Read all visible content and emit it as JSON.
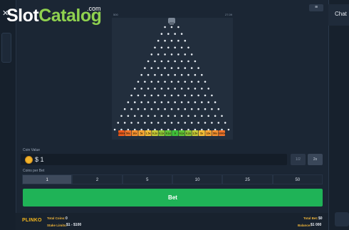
{
  "watermark": {
    "slot": "Slot",
    "catalog": "Catalog",
    "com": ".com"
  },
  "close_glyph": "✕",
  "chat": {
    "label": "Chat"
  },
  "menu_glyph": "≡",
  "board": {
    "left_label": "500",
    "right_label": "27.09",
    "rows": 16,
    "multipliers": [
      "1000x",
      "50x",
      "10x",
      "5x",
      "1.5x",
      "0.2x",
      "0.1x",
      "0.1x",
      "0",
      "0.1x",
      "0.2x",
      "1.5x",
      "5x",
      "10x",
      "50x",
      "1000x"
    ],
    "slot_colors": [
      "#ee5a1c",
      "#f0742a",
      "#f3902f",
      "#f5a533",
      "#f2bd36",
      "#c3c937",
      "#8cc637",
      "#5fc236",
      "#3fbf39",
      "#5fc236",
      "#8cc637",
      "#c3c937",
      "#f2bd36",
      "#f5a533",
      "#f3902f",
      "#f0742a",
      "#ee5a1c"
    ]
  },
  "bet_panel": {
    "coin_value_label": "Coin Value",
    "coin_value": "$ 1",
    "half_label": "1/2",
    "double_label": "2x",
    "coins_per_bet_label": "Coins per Bet",
    "coins_options": [
      "1",
      "2",
      "5",
      "10",
      "25",
      "50"
    ],
    "coins_selected": "1",
    "bet_label": "Bet"
  },
  "footer": {
    "logo": "PLINKO",
    "total_coins_label": "Total Coins:",
    "total_coins_value": "0",
    "stake_limits_label": "Stake Limits:",
    "stake_limits_value": "$1 - $100",
    "total_bet_label": "Total Bet:",
    "total_bet_value": "$0",
    "balance_label": "Balance:",
    "balance_value": "$1 000"
  }
}
